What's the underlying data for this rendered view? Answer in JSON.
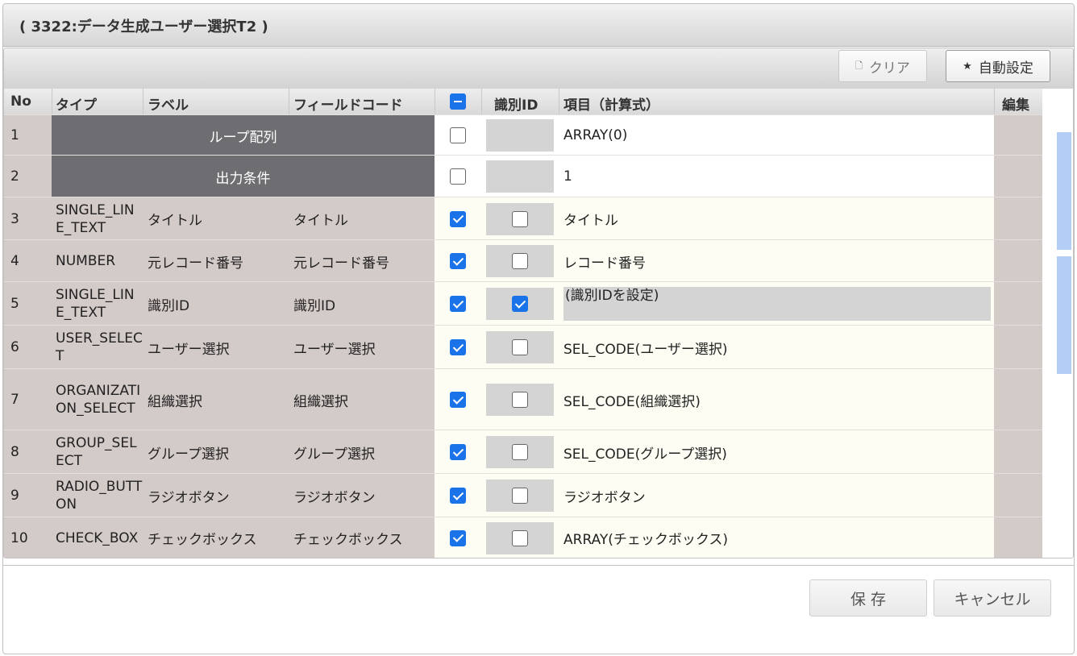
{
  "window": {
    "title": "( 3322:データ生成ユーザー選択T2 )"
  },
  "toolbar": {
    "clear_label": "クリア",
    "auto_label": "自動設定",
    "clear_icon": "document-icon",
    "auto_icon": "star-icon"
  },
  "table": {
    "headers": {
      "no": "No",
      "type": "タイプ",
      "label": "ラベル",
      "field_code": "フィールドコード",
      "id": "識別ID",
      "expression": "項目（計算式）",
      "edit": "編集"
    },
    "header_checkbox_state": "indeterminate",
    "rows": [
      {
        "no": "1",
        "merged": "ループ配列",
        "checked": false,
        "id": null,
        "expression": "ARRAY(0)"
      },
      {
        "no": "2",
        "merged": "出力条件",
        "checked": false,
        "id": null,
        "expression": "1"
      },
      {
        "no": "3",
        "type": "SINGLE_LINE_TEXT",
        "label": "タイトル",
        "code": "タイトル",
        "checked": true,
        "id": false,
        "expression": "タイトル"
      },
      {
        "no": "4",
        "type": "NUMBER",
        "label": "元レコード番号",
        "code": "元レコード番号",
        "checked": true,
        "id": false,
        "expression": "レコード番号"
      },
      {
        "no": "5",
        "type": "SINGLE_LINE_TEXT",
        "label": "識別ID",
        "code": "識別ID",
        "checked": true,
        "id": true,
        "expression": "(識別IDを設定)"
      },
      {
        "no": "6",
        "type": "USER_SELECT",
        "label": "ユーザー選択",
        "code": "ユーザー選択",
        "checked": true,
        "id": false,
        "expression": "SEL_CODE(ユーザー選択)"
      },
      {
        "no": "7",
        "type": "ORGANIZATION_SELECT",
        "label": "組織選択",
        "code": "組織選択",
        "checked": true,
        "id": false,
        "expression": "SEL_CODE(組織選択)"
      },
      {
        "no": "8",
        "type": "GROUP_SELECT",
        "label": "グループ選択",
        "code": "グループ選択",
        "checked": true,
        "id": false,
        "expression": "SEL_CODE(グループ選択)"
      },
      {
        "no": "9",
        "type": "RADIO_BUTTON",
        "label": "ラジオボタン",
        "code": "ラジオボタン",
        "checked": true,
        "id": false,
        "expression": "ラジオボタン"
      },
      {
        "no": "10",
        "type": "CHECK_BOX",
        "label": "チェックボックス",
        "code": "チェックボックス",
        "checked": true,
        "id": false,
        "expression": "ARRAY(チェックボックス)"
      }
    ]
  },
  "footer": {
    "save_label": "保 存",
    "cancel_label": "キャンセル"
  },
  "colors": {
    "accent": "#1a73e8",
    "loop_row": "#6e6e72",
    "readonly_cell": "#d3cbc8"
  }
}
